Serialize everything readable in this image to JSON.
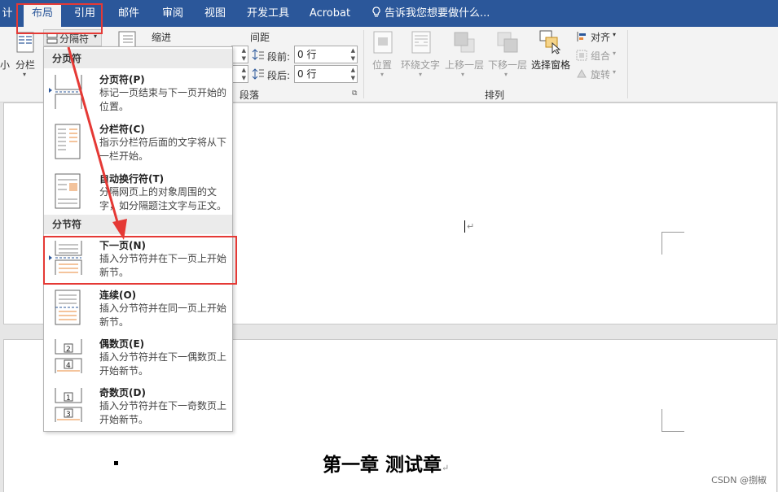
{
  "tabs": [
    {
      "label": "计"
    },
    {
      "label": "布局",
      "active": true
    },
    {
      "label": "引用"
    },
    {
      "label": "邮件"
    },
    {
      "label": "审阅"
    },
    {
      "label": "视图"
    },
    {
      "label": "开发工具"
    },
    {
      "label": "Acrobat"
    }
  ],
  "tell_me": "告诉我您想要做什么...",
  "ribbon": {
    "columns_label": "分栏",
    "small_label": "小",
    "breaks_label": "分隔符",
    "indent_label": "缩进",
    "spacing_label": "间距",
    "before_label": "段前:",
    "after_label": "段后:",
    "before_value": "0 行",
    "after_value": "0 行",
    "paragraph_group": "段落",
    "arrange_group": "排列",
    "position": "位置",
    "wrap_text": "环绕文字",
    "bring_forward": "上移一层",
    "send_backward": "下移一层",
    "selection_pane": "选择窗格",
    "align": "对齐",
    "group": "组合",
    "rotate": "旋转"
  },
  "menu": {
    "page_breaks_header": "分页符",
    "section_breaks_header": "分节符",
    "items": [
      {
        "title": "分页符(P)",
        "desc": "标记一页结束与下一页开始的位置。",
        "icon": "page-break-icon"
      },
      {
        "title": "分栏符(C)",
        "desc": "指示分栏符后面的文字将从下一栏开始。",
        "icon": "column-break-icon"
      },
      {
        "title": "自动换行符(T)",
        "desc": "分隔网页上的对象周围的文字，如分隔题注文字与正文。",
        "icon": "text-wrapping-break-icon"
      },
      {
        "title": "下一页(N)",
        "desc": "插入分节符并在下一页上开始新节。",
        "icon": "next-page-icon"
      },
      {
        "title": "连续(O)",
        "desc": "插入分节符并在同一页上开始新节。",
        "icon": "continuous-icon"
      },
      {
        "title": "偶数页(E)",
        "desc": "插入分节符并在下一偶数页上开始新节。",
        "icon": "even-page-icon"
      },
      {
        "title": "奇数页(D)",
        "desc": "插入分节符并在下一奇数页上开始新节。",
        "icon": "odd-page-icon"
      }
    ]
  },
  "document": {
    "chapter_title": "第一章  测试章",
    "paragraph_mark": "↵"
  },
  "watermark": "CSDN @捌椒",
  "colors": {
    "ribbon_blue": "#2b579a",
    "highlight_red": "#e53935",
    "accent_orange": "#e8883a"
  }
}
